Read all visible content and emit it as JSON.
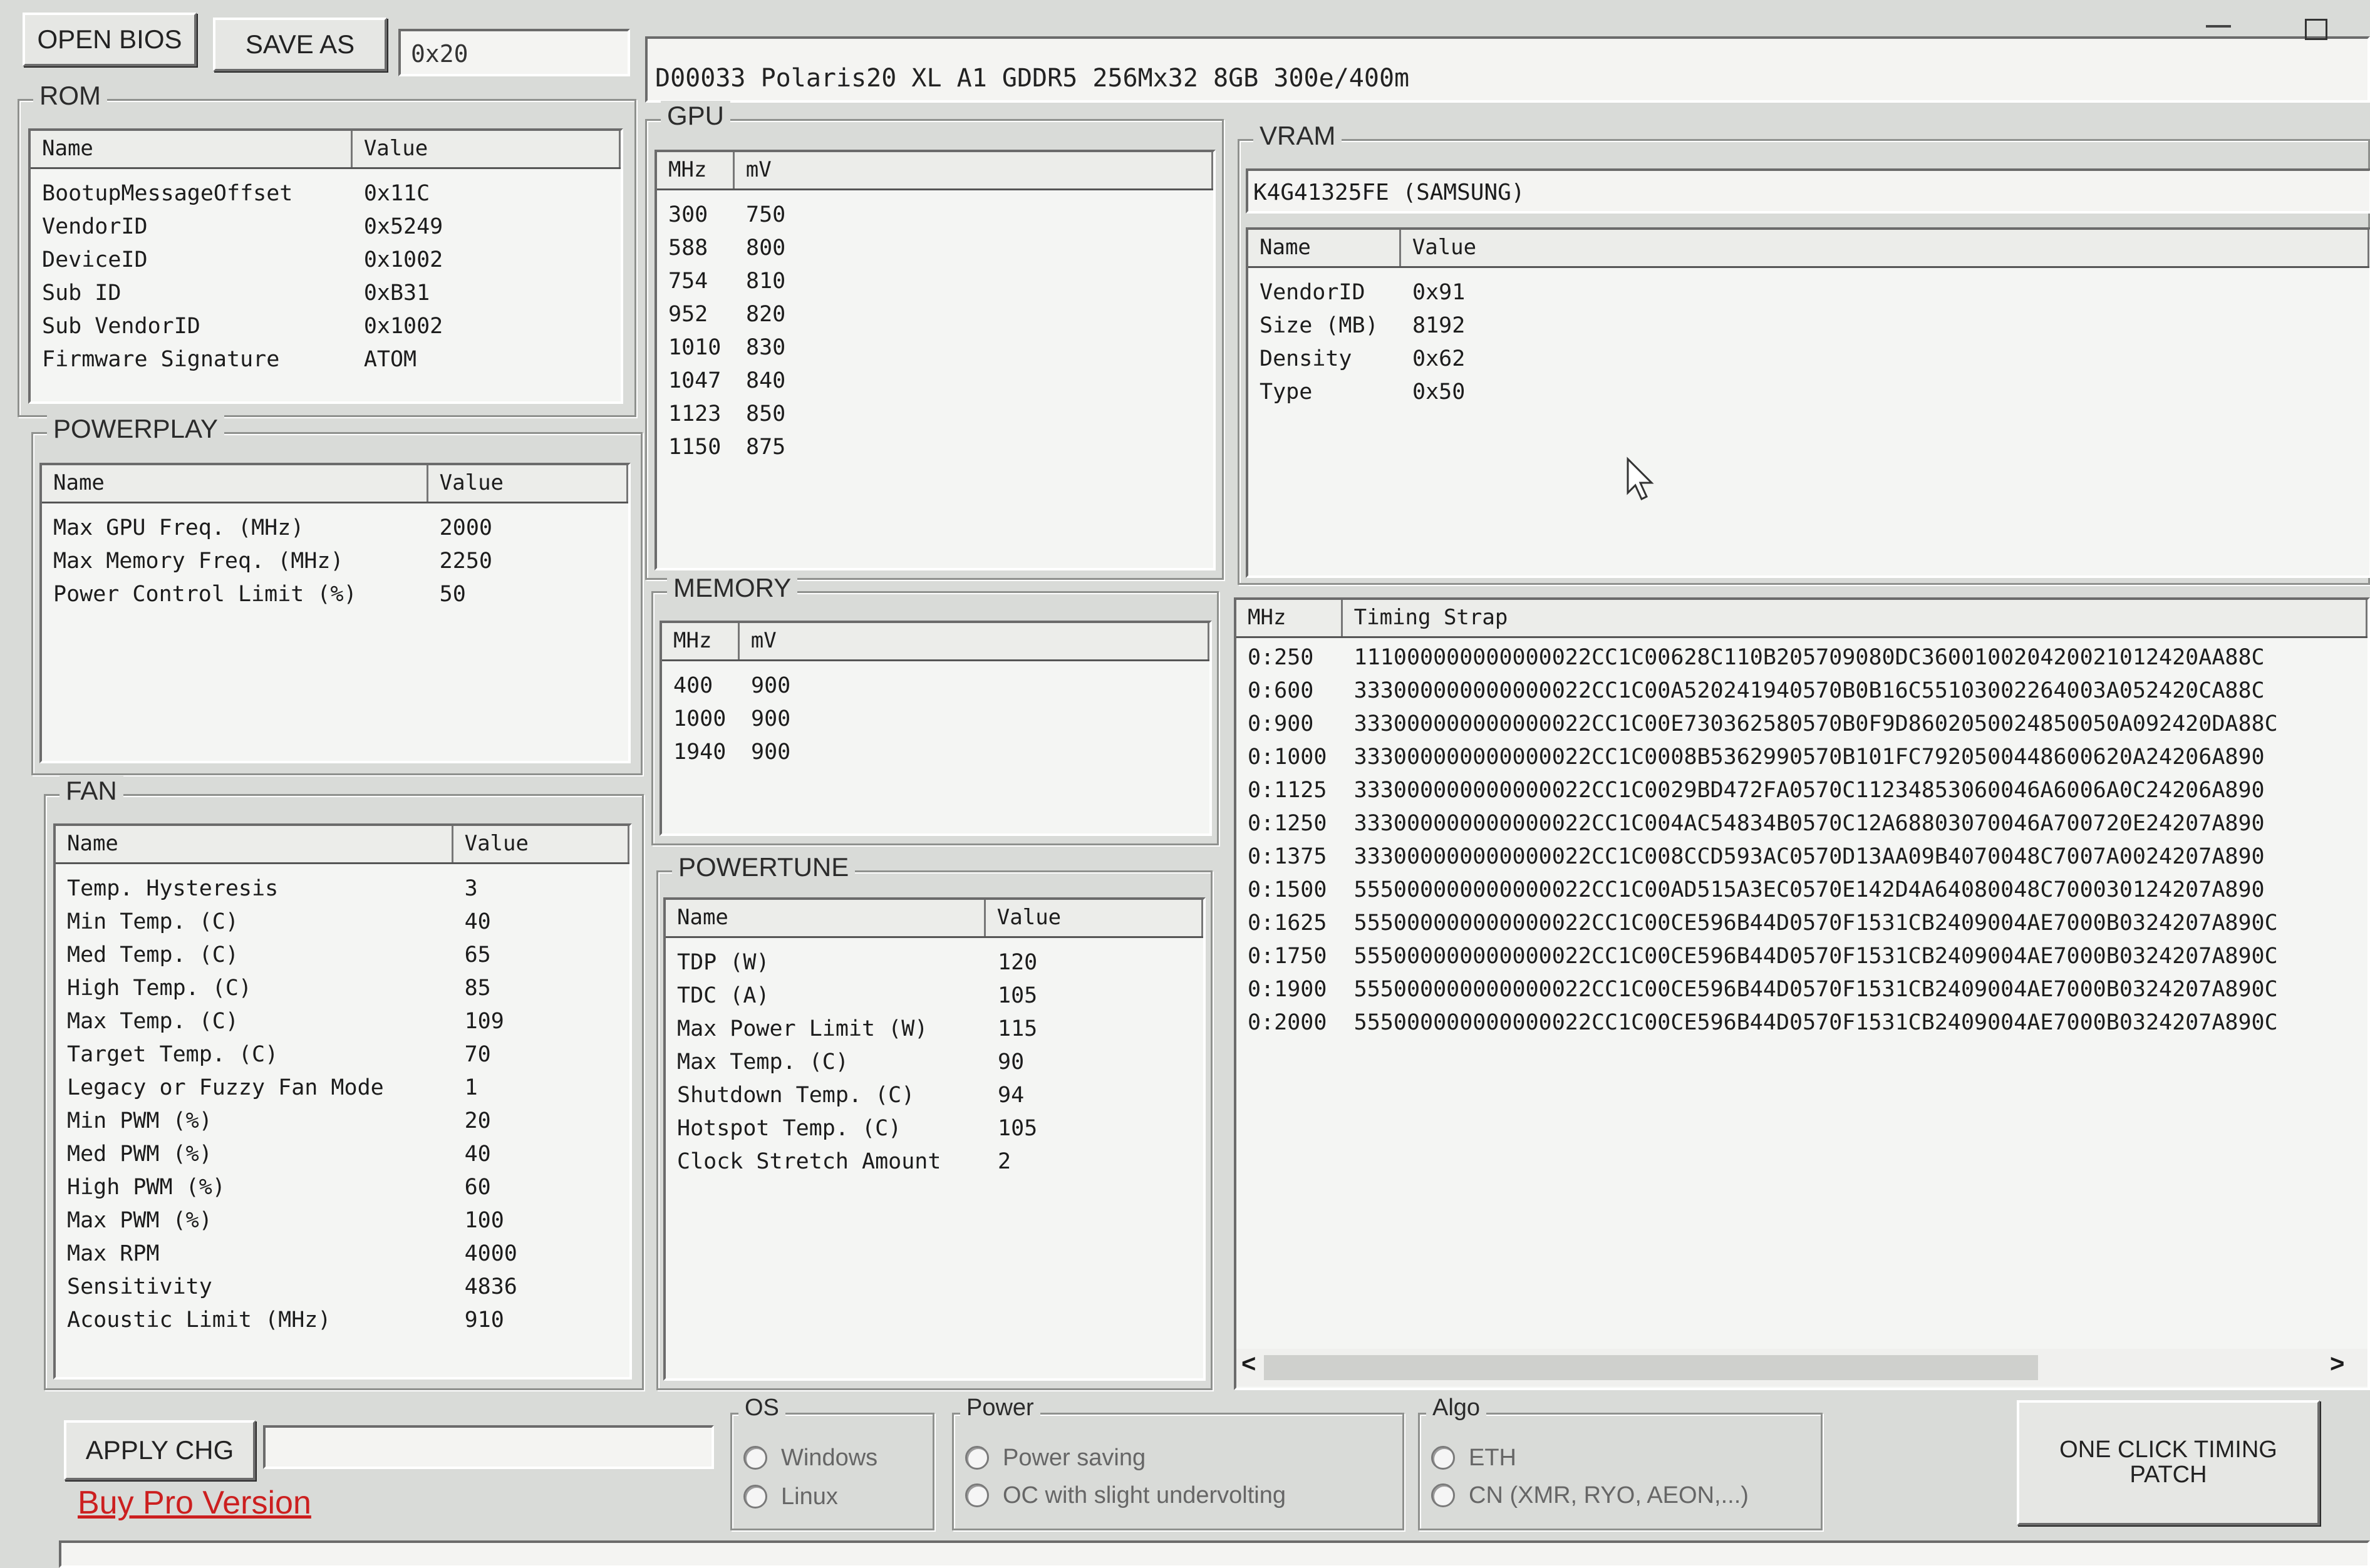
{
  "window": {
    "open_bios_label": "OPEN BIOS",
    "save_as_label": "SAVE AS",
    "offset_value": "0x20",
    "bios_info": "D00033 Polaris20 XL A1 GDDR5 256Mx32 8GB 300e/400m",
    "minimize_icon": "minimize-icon",
    "maximize_icon": "maximize-icon"
  },
  "rom": {
    "title": "ROM",
    "columns": [
      "Name",
      "Value"
    ],
    "rows": [
      [
        "BootupMessageOffset",
        "0x11C"
      ],
      [
        "VendorID",
        "0x5249"
      ],
      [
        "DeviceID",
        "0x1002"
      ],
      [
        "Sub ID",
        "0xB31"
      ],
      [
        "Sub VendorID",
        "0x1002"
      ],
      [
        "Firmware Signature",
        "ATOM"
      ]
    ]
  },
  "powerplay": {
    "title": "POWERPLAY",
    "columns": [
      "Name",
      "Value"
    ],
    "rows": [
      [
        "Max GPU Freq. (MHz)",
        "2000"
      ],
      [
        "Max Memory Freq. (MHz)",
        "2250"
      ],
      [
        "Power Control Limit (%)",
        "50"
      ]
    ]
  },
  "fan": {
    "title": "FAN",
    "columns": [
      "Name",
      "Value"
    ],
    "rows": [
      [
        "Temp. Hysteresis",
        "3"
      ],
      [
        "Min Temp. (C)",
        "40"
      ],
      [
        "Med Temp. (C)",
        "65"
      ],
      [
        "High Temp. (C)",
        "85"
      ],
      [
        "Max Temp. (C)",
        "109"
      ],
      [
        "Target Temp. (C)",
        "70"
      ],
      [
        "Legacy or Fuzzy Fan Mode",
        "1"
      ],
      [
        "Min PWM (%)",
        "20"
      ],
      [
        "Med PWM (%)",
        "40"
      ],
      [
        "High PWM (%)",
        "60"
      ],
      [
        "Max PWM (%)",
        "100"
      ],
      [
        "Max RPM",
        "4000"
      ],
      [
        "Sensitivity",
        "4836"
      ],
      [
        "Acoustic Limit (MHz)",
        "910"
      ]
    ]
  },
  "gpu": {
    "title": "GPU",
    "columns": [
      "MHz",
      "mV"
    ],
    "rows": [
      [
        "300",
        "750"
      ],
      [
        "588",
        "800"
      ],
      [
        "754",
        "810"
      ],
      [
        "952",
        "820"
      ],
      [
        "1010",
        "830"
      ],
      [
        "1047",
        "840"
      ],
      [
        "1123",
        "850"
      ],
      [
        "1150",
        "875"
      ]
    ]
  },
  "memory": {
    "title": "MEMORY",
    "columns": [
      "MHz",
      "mV"
    ],
    "rows": [
      [
        "400",
        "900"
      ],
      [
        "1000",
        "900"
      ],
      [
        "1940",
        "900"
      ]
    ]
  },
  "powertune": {
    "title": "POWERTUNE",
    "columns": [
      "Name",
      "Value"
    ],
    "rows": [
      [
        "TDP (W)",
        "120"
      ],
      [
        "TDC (A)",
        "105"
      ],
      [
        "Max Power Limit (W)",
        "115"
      ],
      [
        "Max Temp. (C)",
        "90"
      ],
      [
        "Shutdown Temp. (C)",
        "94"
      ],
      [
        "Hotspot Temp. (C)",
        "105"
      ],
      [
        "Clock Stretch Amount",
        "2"
      ]
    ]
  },
  "vram": {
    "title": "VRAM",
    "selected_module": "K4G41325FE (SAMSUNG)",
    "columns": [
      "Name",
      "Value"
    ],
    "rows": [
      [
        "VendorID",
        "0x91"
      ],
      [
        "Size (MB)",
        "8192"
      ],
      [
        "Density",
        "0x62"
      ],
      [
        "Type",
        "0x50"
      ]
    ]
  },
  "timings": {
    "columns": [
      "MHz",
      "Timing Strap"
    ],
    "rows": [
      [
        "0:250",
        "111000000000000022CC1C00628C110B205709080DC360010020420021012420AA88C"
      ],
      [
        "0:600",
        "333000000000000022CC1C00A520241940570B0B16C55103002264003A052420CA88C"
      ],
      [
        "0:900",
        "333000000000000022CC1C00E730362580570B0F9D8602050024850050A092420DA88C"
      ],
      [
        "0:1000",
        "333000000000000022CC1C0008B5362990570B101FC7920500448600620A24206A890"
      ],
      [
        "0:1125",
        "333000000000000022CC1C0029BD472FA0570C11234853060046A6006A0C24206A890"
      ],
      [
        "0:1250",
        "333000000000000022CC1C004AC54834B0570C12A68803070046A700720E24207A890"
      ],
      [
        "0:1375",
        "333000000000000022CC1C008CCD593AC0570D13AA09B4070048C7007A0024207A890"
      ],
      [
        "0:1500",
        "555000000000000022CC1C00AD515A3EC0570E142D4A64080048C700030124207A890"
      ],
      [
        "0:1625",
        "555000000000000022CC1C00CE596B44D0570F1531CB2409004AE7000B0324207A890C"
      ],
      [
        "0:1750",
        "555000000000000022CC1C00CE596B44D0570F1531CB2409004AE7000B0324207A890C"
      ],
      [
        "0:1900",
        "555000000000000022CC1C00CE596B44D0570F1531CB2409004AE7000B0324207A890C"
      ],
      [
        "0:2000",
        "555000000000000022CC1C00CE596B44D0570F1531CB2409004AE7000B0324207A890C"
      ]
    ],
    "scroll_left": "<",
    "scroll_right": ">"
  },
  "bottom": {
    "apply_label": "APPLY CHG",
    "apply_field_value": "",
    "buy_pro_label": "Buy Pro Version",
    "buy_pro_color": "#cc1f1f",
    "os_group": {
      "title": "OS",
      "options": [
        "Windows",
        "Linux"
      ]
    },
    "power_group": {
      "title": "Power",
      "options": [
        "Power saving",
        "OC with slight undervolting"
      ]
    },
    "algo_group": {
      "title": "Algo",
      "options": [
        "ETH",
        "CN (XMR, RYO, AEON,...)"
      ]
    },
    "one_click_label": "ONE CLICK TIMING PATCH"
  }
}
